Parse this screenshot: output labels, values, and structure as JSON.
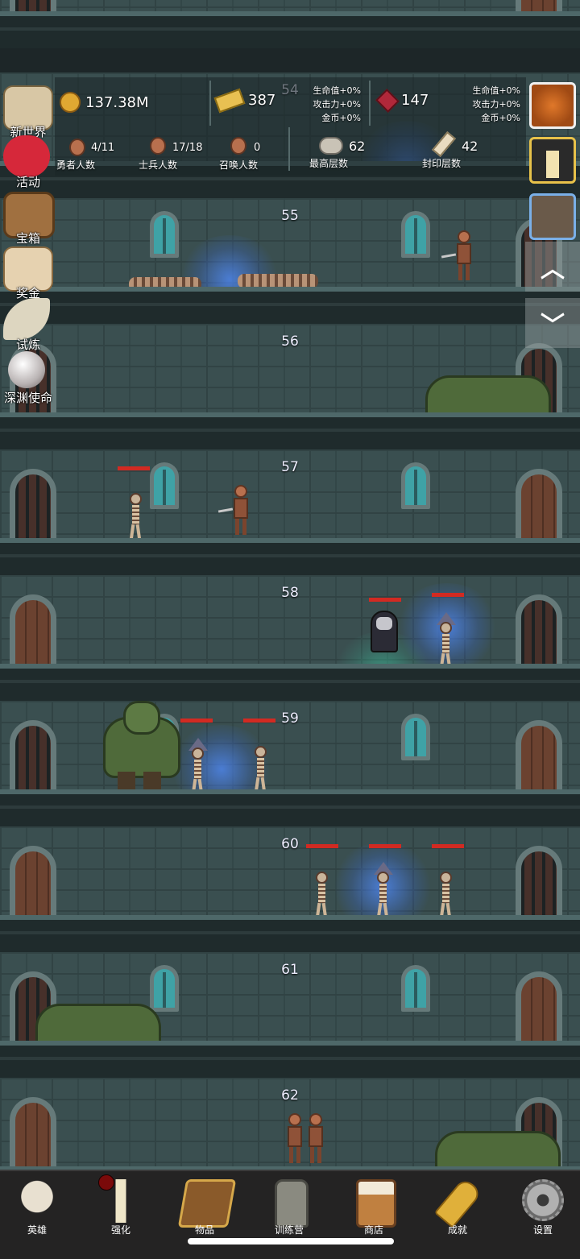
{
  "resources": {
    "gold": "137.38M",
    "bars": "387",
    "gems": "147",
    "bonus_a": [
      "生命值+0%",
      "攻击力+0%",
      "金币+0%"
    ],
    "bonus_b": [
      "生命值+0%",
      "攻击力+0%",
      "金币+0%"
    ]
  },
  "stats": {
    "heroes": {
      "value": "4/11",
      "label": "勇者人数"
    },
    "soldiers": {
      "value": "17/18",
      "label": "士兵人数"
    },
    "summons": {
      "value": "0",
      "label": "召唤人数"
    },
    "max_floor": {
      "value": "62",
      "label": "最高层数"
    },
    "sealed_floor": {
      "value": "42",
      "label": "封印层数"
    }
  },
  "floors": [
    "54",
    "55",
    "56",
    "57",
    "58",
    "59",
    "60",
    "61",
    "62"
  ],
  "left_menu": [
    "新世界",
    "活动",
    "宝箱",
    "奖金",
    "试炼",
    "深渊使命"
  ],
  "bottom_nav": [
    "英雄",
    "强化",
    "物品",
    "训练营",
    "商店",
    "成就",
    "设置"
  ],
  "colors": {
    "hp_bar": "#d22a22",
    "wall": "#3a4f50",
    "nav_bg": "#242323"
  }
}
